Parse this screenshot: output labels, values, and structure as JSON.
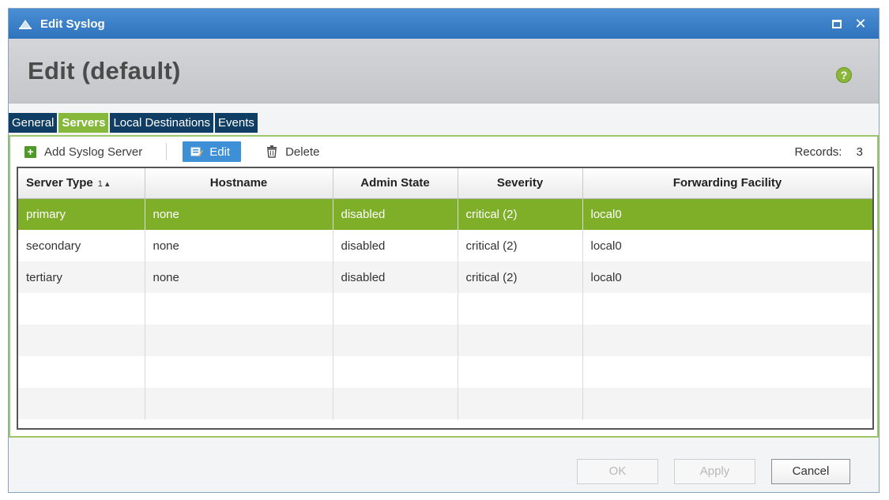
{
  "window": {
    "title": "Edit Syslog"
  },
  "header": {
    "title": "Edit (default)"
  },
  "tabs": [
    {
      "label": "General",
      "active": false
    },
    {
      "label": "Servers",
      "active": true
    },
    {
      "label": "Local Destinations",
      "active": false
    },
    {
      "label": "Events",
      "active": false
    }
  ],
  "toolbar": {
    "add_label": "Add Syslog Server",
    "edit_label": "Edit",
    "delete_label": "Delete",
    "records_label": "Records:",
    "records_count": "3"
  },
  "table": {
    "columns": [
      "Server Type",
      "Hostname",
      "Admin State",
      "Severity",
      "Forwarding Facility"
    ],
    "sort_indicator": "1 ▴",
    "rows": [
      [
        "primary",
        "none",
        "disabled",
        "critical (2)",
        "local0"
      ],
      [
        "secondary",
        "none",
        "disabled",
        "critical (2)",
        "local0"
      ],
      [
        "tertiary",
        "none",
        "disabled",
        "critical (2)",
        "local0"
      ]
    ]
  },
  "footer": {
    "ok_label": "OK",
    "apply_label": "Apply",
    "cancel_label": "Cancel"
  },
  "colors": {
    "titlebar": "#3a81c9",
    "tab_active": "#86b83b",
    "tab_inactive": "#0f3d63",
    "selected_row": "#7fae29",
    "edit_button": "#3d8fd6"
  }
}
